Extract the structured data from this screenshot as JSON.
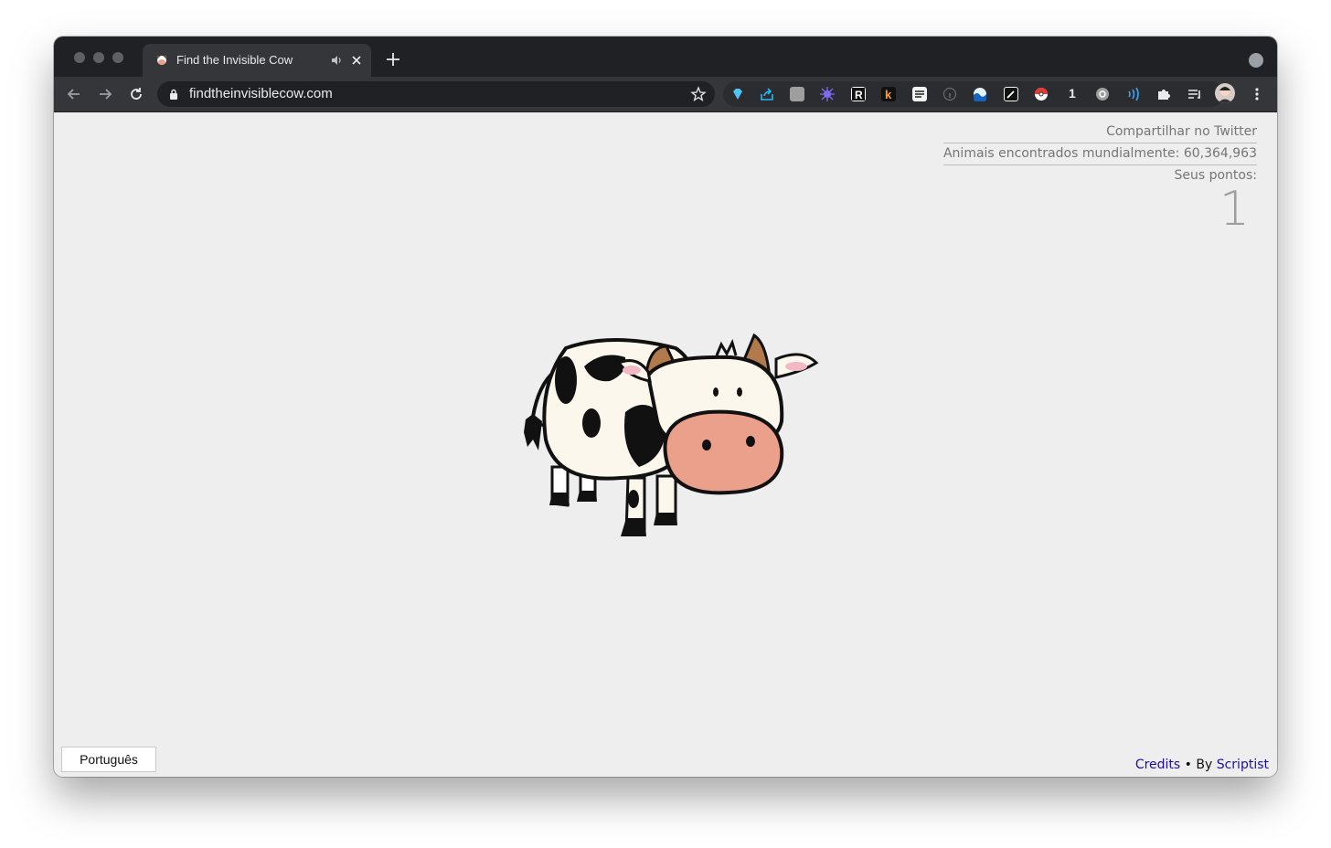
{
  "browser": {
    "tab_title": "Find the Invisible Cow",
    "url": "findtheinvisiblecow.com",
    "extension_badge": "1"
  },
  "page": {
    "share_label": "Compartilhar no Twitter",
    "global_count": "Animais encontrados mundialmente: 60,364,963",
    "points_label": "Seus pontos:",
    "points_value": "1",
    "language": "Português",
    "credits_label": "Credits",
    "by_text": " • By ",
    "author": "Scriptist"
  },
  "icons": {
    "tab_favicon": "cow-icon",
    "audio": "speaker-icon",
    "close": "close-icon",
    "new_tab": "plus-icon",
    "back": "arrow-left-icon",
    "forward": "arrow-right-icon",
    "reload": "reload-icon",
    "lock": "lock-icon",
    "bookmark": "star-icon",
    "extensions": "puzzle-icon",
    "menu": "kebab-menu-icon"
  },
  "colors": {
    "page_bg": "#eeeeee",
    "chrome_dark": "#202124",
    "link": "#1a0dab",
    "cow_nose": "#eba08c"
  }
}
